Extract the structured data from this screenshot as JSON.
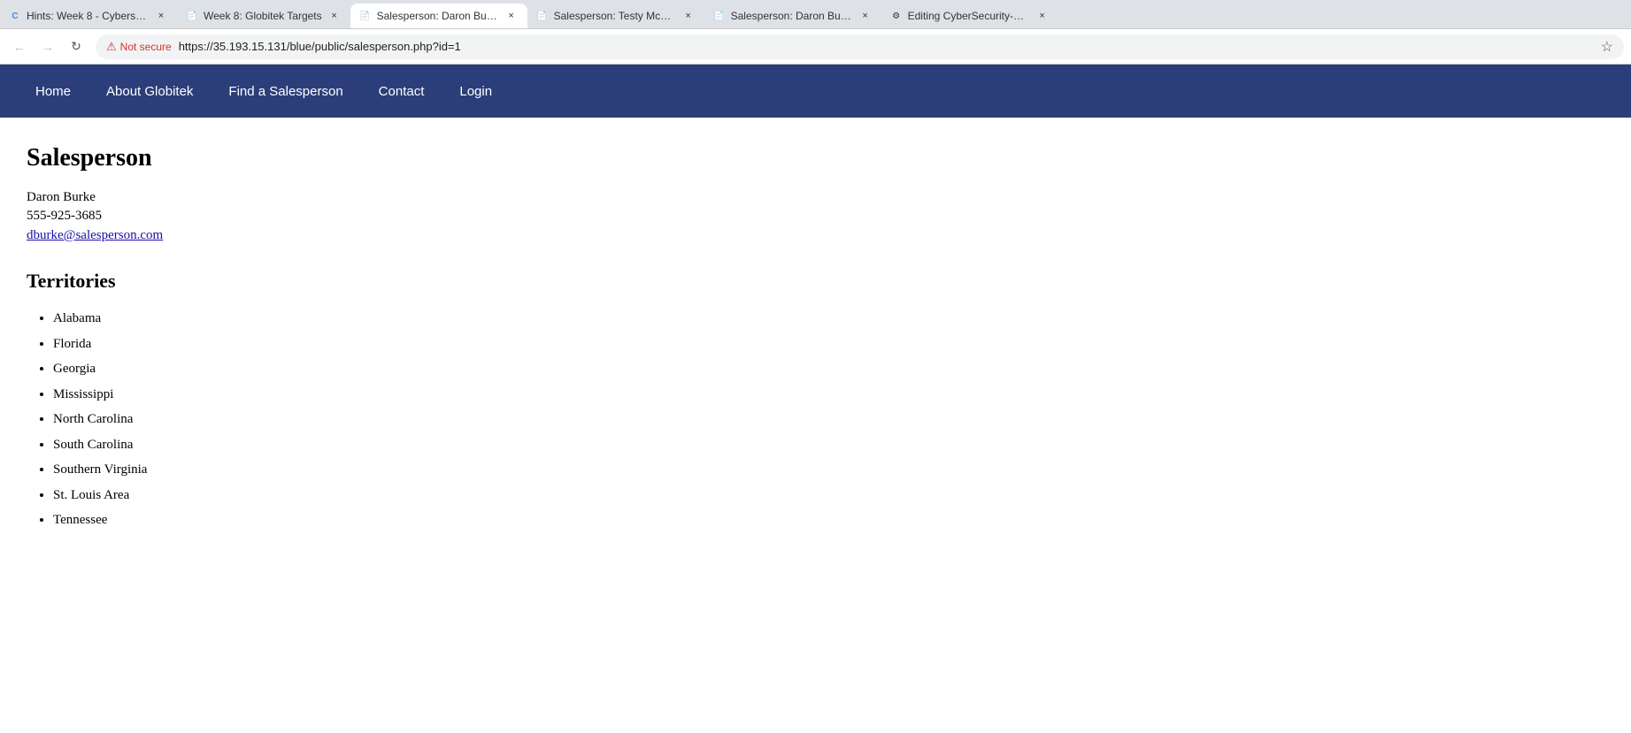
{
  "browser": {
    "tabs": [
      {
        "id": "tab-1",
        "favicon": "C",
        "favicon_color": "#4285f4",
        "title": "Hints: Week 8 - Cyberse...",
        "active": false
      },
      {
        "id": "tab-2",
        "favicon": "📄",
        "title": "Week 8: Globitek Targets",
        "active": false
      },
      {
        "id": "tab-3",
        "favicon": "📄",
        "title": "Salesperson: Daron Burk...",
        "active": true
      },
      {
        "id": "tab-4",
        "favicon": "📄",
        "title": "Salesperson: Testy McTe...",
        "active": false
      },
      {
        "id": "tab-5",
        "favicon": "📄",
        "title": "Salesperson: Daron Burk...",
        "active": false
      },
      {
        "id": "tab-6",
        "favicon": "🐙",
        "title": "Editing CyberSecurity-W...",
        "active": false
      }
    ],
    "address_bar": {
      "security_label": "Not secure",
      "url": "https://35.193.15.131/blue/public/salesperson.php?id=1"
    }
  },
  "nav": {
    "items": [
      {
        "label": "Home",
        "href": "#"
      },
      {
        "label": "About Globitek",
        "href": "#"
      },
      {
        "label": "Find a Salesperson",
        "href": "#"
      },
      {
        "label": "Contact",
        "href": "#"
      },
      {
        "label": "Login",
        "href": "#"
      }
    ]
  },
  "page": {
    "title": "Salesperson",
    "salesperson": {
      "name": "Daron Burke",
      "phone": "555-925-3685",
      "email": "dburke@salesperson.com"
    },
    "territories_title": "Territories",
    "territories": [
      "Alabama",
      "Florida",
      "Georgia",
      "Mississippi",
      "North Carolina",
      "South Carolina",
      "Southern Virginia",
      "St. Louis Area",
      "Tennessee"
    ]
  }
}
